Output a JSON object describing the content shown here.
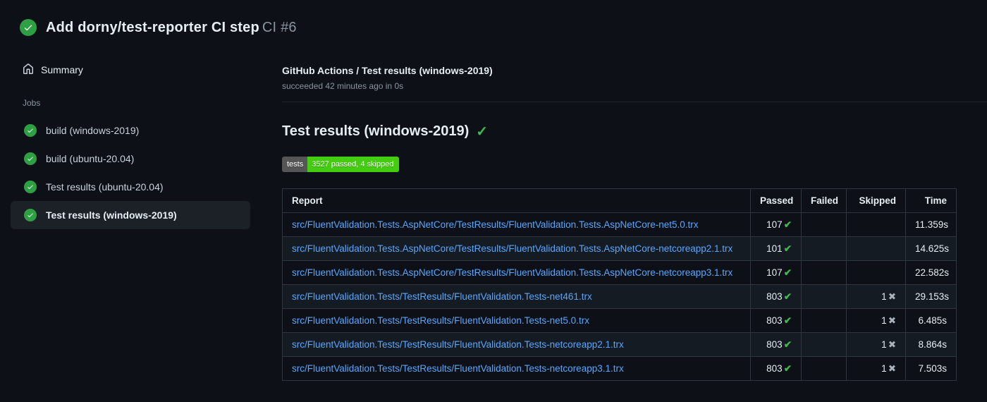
{
  "header": {
    "title": "Add dorny/test-reporter CI step",
    "run_label": "CI #6"
  },
  "sidebar": {
    "summary_label": "Summary",
    "jobs_label": "Jobs",
    "jobs": [
      {
        "label": "build (windows-2019)",
        "selected": false
      },
      {
        "label": "build (ubuntu-20.04)",
        "selected": false
      },
      {
        "label": "Test results (ubuntu-20.04)",
        "selected": false
      },
      {
        "label": "Test results (windows-2019)",
        "selected": true
      }
    ]
  },
  "main": {
    "job_title": "GitHub Actions / Test results (windows-2019)",
    "job_status": "succeeded 42 minutes ago in 0s",
    "section_heading": "Test results (windows-2019)",
    "section_heading_check": "✓",
    "badge": {
      "label": "tests",
      "value": "3527 passed, 4 skipped",
      "label_bg": "#555555",
      "value_bg": "#44cc11"
    },
    "table": {
      "columns": [
        "Report",
        "Passed",
        "Failed",
        "Skipped",
        "Time"
      ],
      "rows": [
        {
          "report": "src/FluentValidation.Tests.AspNetCore/TestResults/FluentValidation.Tests.AspNetCore-net5.0.trx",
          "passed": "107",
          "passed_icon": "✔",
          "failed": "",
          "skipped": "",
          "skipped_icon": "",
          "time": "11.359s"
        },
        {
          "report": "src/FluentValidation.Tests.AspNetCore/TestResults/FluentValidation.Tests.AspNetCore-netcoreapp2.1.trx",
          "passed": "101",
          "passed_icon": "✔",
          "failed": "",
          "skipped": "",
          "skipped_icon": "",
          "time": "14.625s"
        },
        {
          "report": "src/FluentValidation.Tests.AspNetCore/TestResults/FluentValidation.Tests.AspNetCore-netcoreapp3.1.trx",
          "passed": "107",
          "passed_icon": "✔",
          "failed": "",
          "skipped": "",
          "skipped_icon": "",
          "time": "22.582s"
        },
        {
          "report": "src/FluentValidation.Tests/TestResults/FluentValidation.Tests-net461.trx",
          "passed": "803",
          "passed_icon": "✔",
          "failed": "",
          "skipped": "1",
          "skipped_icon": "✖",
          "time": "29.153s"
        },
        {
          "report": "src/FluentValidation.Tests/TestResults/FluentValidation.Tests-net5.0.trx",
          "passed": "803",
          "passed_icon": "✔",
          "failed": "",
          "skipped": "1",
          "skipped_icon": "✖",
          "time": "6.485s"
        },
        {
          "report": "src/FluentValidation.Tests/TestResults/FluentValidation.Tests-netcoreapp2.1.trx",
          "passed": "803",
          "passed_icon": "✔",
          "failed": "",
          "skipped": "1",
          "skipped_icon": "✖",
          "time": "8.864s"
        },
        {
          "report": "src/FluentValidation.Tests/TestResults/FluentValidation.Tests-netcoreapp3.1.trx",
          "passed": "803",
          "passed_icon": "✔",
          "failed": "",
          "skipped": "1",
          "skipped_icon": "✖",
          "time": "7.503s"
        }
      ]
    }
  },
  "colors": {
    "background": "#0d1117",
    "text_primary": "#e6edf3",
    "text_secondary": "#8b949e",
    "success_green": "#2ea043",
    "check_green": "#3fb950",
    "link_blue": "#58a6ff",
    "table_border": "#30363d",
    "row_alt": "#151b23",
    "selected_item_bg": "#1c2128",
    "badge_label_bg": "#555555",
    "badge_value_bg": "#44cc11"
  }
}
